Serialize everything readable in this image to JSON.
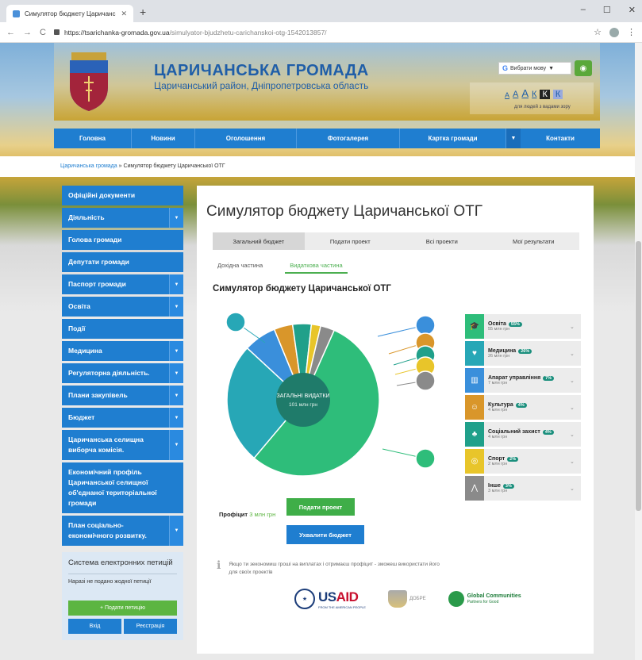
{
  "browser": {
    "tab_title": "Симулятор бюджету Царичансь",
    "url_host": "https://tsarichanka-gromada.gov.ua",
    "url_path": "/simulyator-bjudzhetu-carichanskoi-otg-1542013857/"
  },
  "site": {
    "title": "ЦАРИЧАНСЬКА ГРОМАДА",
    "subtitle": "Царичанський район, Дніпропетровська область",
    "lang_label": "Вибрати мову",
    "a11y_letters": [
      "А",
      "А",
      "А",
      "К",
      "К",
      "К"
    ],
    "a11y_note": "для людей з вадами зору"
  },
  "nav": [
    "Головна",
    "Новини",
    "Оголошення",
    "Фотогалерея",
    "Картка громади",
    "Контакти"
  ],
  "breadcrumb": {
    "home": "Царичанська громада",
    "sep": " » ",
    "current": "Симулятор бюджету Царичанської ОТГ"
  },
  "sidebar": {
    "items": [
      {
        "label": "Офіційні документи",
        "dd": false
      },
      {
        "label": "Діяльність",
        "dd": true
      },
      {
        "label": "Голова громади",
        "dd": false
      },
      {
        "label": "Депутати громади",
        "dd": false
      },
      {
        "label": "Паспорт громади",
        "dd": true
      },
      {
        "label": "Освіта",
        "dd": true
      },
      {
        "label": "Події",
        "dd": false
      },
      {
        "label": "Медицина",
        "dd": true
      },
      {
        "label": "Регуляторна діяльність.",
        "dd": true
      },
      {
        "label": "Плани закупівель",
        "dd": true
      },
      {
        "label": "Бюджет",
        "dd": true
      },
      {
        "label": "Царичанська селищна виборча комісія.",
        "dd": true
      },
      {
        "label": "Економічний профіль Царичанської селищної об'єднаної територіальної громади",
        "dd": false
      },
      {
        "label": "План соціально-економічного розвитку.",
        "dd": true
      }
    ],
    "petitions": {
      "title": "Система електронних петицій",
      "none": "Наразі не подано жодної петиції",
      "submit": "+ Подати петицію",
      "login": "Вхід",
      "register": "Реєстрація"
    }
  },
  "main": {
    "title": "Симулятор бюджету Царичанської ОТГ",
    "tabs": [
      "Загальний бюджет",
      "Подати проект",
      "Всі проекти",
      "Мої результати"
    ],
    "subtabs": [
      "Дохідна частина",
      "Видаткова частина"
    ],
    "section_title": "Симулятор бюджету Царичанської ОТГ",
    "center_label": "ЗАГАЛЬНІ ВИДАТКИ",
    "center_value": "101 млн грн",
    "profit_label": "Профіцит",
    "profit_value": "3 млн грн",
    "submit_button": "Подати проект",
    "approve_button": "Ухвалити бюджет",
    "hint": "Якщо ти зекономиш гроші на виплатах і отримаєш профіцит - зможеш використати його для своїх проектів",
    "logos": {
      "usaid_a": "US",
      "usaid_b": "AID",
      "usaid_sub": "FROM THE AMERICAN PEOPLE",
      "dobre": "ДОБРЕ",
      "gc": "Global Communities",
      "gc_sub": "Partners for Good"
    }
  },
  "chart_data": {
    "type": "pie",
    "total_label": "101 млн грн",
    "series": [
      {
        "name": "Освіта",
        "percent": 55,
        "amount": "55 млн грн",
        "color": "#2ebd7a"
      },
      {
        "name": "Медицина",
        "percent": 26,
        "amount": "26 млн грн",
        "color": "#27a7b6"
      },
      {
        "name": "Апарат управління",
        "percent": 7,
        "amount": "7 млн грн",
        "color": "#3a8fdb"
      },
      {
        "name": "Культура",
        "percent": 4,
        "amount": "4 млн грн",
        "color": "#d9962a"
      },
      {
        "name": "Соціальний захист",
        "percent": 4,
        "amount": "4 млн грн",
        "color": "#20a08a"
      },
      {
        "name": "Спорт",
        "percent": 2,
        "amount": "2 млн грн",
        "color": "#e8c52a"
      },
      {
        "name": "Інше",
        "percent": 3,
        "amount": "3 млн грн",
        "color": "#8a8a8a"
      }
    ],
    "legend": "right"
  },
  "legend_rows": [
    {
      "name": "Освіта",
      "pct": "55%",
      "amount": "55 млн грн",
      "icon": "graduation-cap-icon",
      "color": "#2ebd7a"
    },
    {
      "name": "Медицина",
      "pct": "26%",
      "amount": "26 млн грн",
      "icon": "heart-pulse-icon",
      "color": "#27a7b6"
    },
    {
      "name": "Апарат управління",
      "pct": "7%",
      "amount": "7 млн грн",
      "icon": "building-icon",
      "color": "#3a8fdb"
    },
    {
      "name": "Культура",
      "pct": "4%",
      "amount": "4 млн грн",
      "icon": "theatre-icon",
      "color": "#d9962a"
    },
    {
      "name": "Соціальний захист",
      "pct": "4%",
      "amount": "4 млн грн",
      "icon": "family-icon",
      "color": "#20a08a"
    },
    {
      "name": "Спорт",
      "pct": "2%",
      "amount": "2 млн грн",
      "icon": "ball-icon",
      "color": "#e8c52a"
    },
    {
      "name": "Інше",
      "pct": "3%",
      "amount": "3 млн грн",
      "icon": "other-icon",
      "color": "#8a8a8a"
    }
  ]
}
